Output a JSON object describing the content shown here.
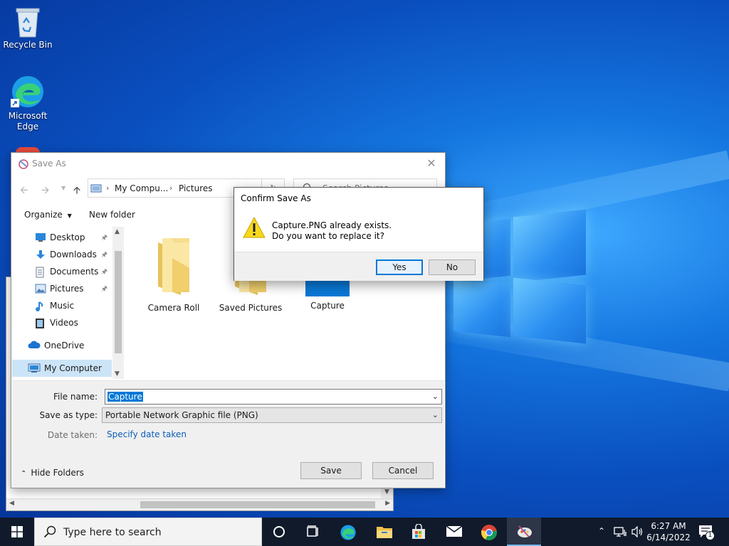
{
  "desktop": {
    "icons": [
      {
        "label": "Recycle Bin"
      },
      {
        "label": "Microsoft Edge"
      }
    ]
  },
  "save_as": {
    "title": "Save As",
    "address": {
      "crumbs": [
        "My Compu...",
        "Pictures"
      ]
    },
    "search_placeholder": "Search Pictures",
    "toolbar": {
      "organize": "Organize",
      "new_folder": "New folder"
    },
    "nav": [
      {
        "label": "Desktop",
        "icon": "desktop-icon",
        "pinned": true
      },
      {
        "label": "Downloads",
        "icon": "download-icon",
        "pinned": true
      },
      {
        "label": "Documents",
        "icon": "documents-icon",
        "pinned": true
      },
      {
        "label": "Pictures",
        "icon": "pictures-icon",
        "pinned": true
      },
      {
        "label": "Music",
        "icon": "music-icon",
        "pinned": false
      },
      {
        "label": "Videos",
        "icon": "videos-icon",
        "pinned": false
      },
      {
        "label": "OneDrive",
        "icon": "onedrive-icon",
        "pinned": false
      },
      {
        "label": "My Computer",
        "icon": "computer-icon",
        "pinned": false,
        "selected": true
      }
    ],
    "files": [
      {
        "label": "Camera Roll",
        "type": "folder"
      },
      {
        "label": "Saved Pictures",
        "type": "folder"
      },
      {
        "label": "Capture",
        "type": "image"
      }
    ],
    "fields": {
      "file_name_label": "File name:",
      "file_name_value": "Capture",
      "save_type_label": "Save as type:",
      "save_type_value": "Portable Network Graphic file (PNG)",
      "date_label": "Date taken:",
      "date_link": "Specify date taken"
    },
    "hide_folders": "Hide Folders",
    "save_button": "Save",
    "cancel_button": "Cancel"
  },
  "confirm": {
    "title": "Confirm Save As",
    "line1": "Capture.PNG already exists.",
    "line2": "Do you want to replace it?",
    "yes": "Yes",
    "no": "No"
  },
  "taskbar": {
    "search_placeholder": "Type here to search",
    "time": "6:27 AM",
    "date": "6/14/2022",
    "notification_count": "1"
  },
  "colors": {
    "accent": "#0078d7",
    "taskbar": "#101a2b",
    "link": "#0c5fb8",
    "desktop": "#0a4fbf"
  }
}
